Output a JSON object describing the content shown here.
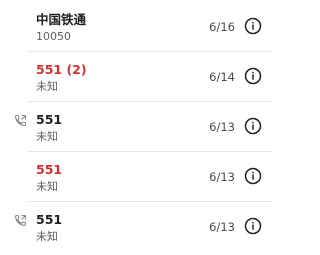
{
  "call_log": {
    "rows": [
      {
        "name": "中国铁通",
        "number_or_location": "10050",
        "date": "6/16",
        "missed": false,
        "call_type_icon": null,
        "info_icon": "info-icon"
      },
      {
        "name": "551 (2)",
        "number_or_location": "未知",
        "date": "6/14",
        "missed": true,
        "call_type_icon": null,
        "info_icon": "info-icon"
      },
      {
        "name": "551",
        "number_or_location": "未知",
        "date": "6/13",
        "missed": false,
        "call_type_icon": "outgoing-call-icon",
        "info_icon": "info-icon"
      },
      {
        "name": "551",
        "number_or_location": "未知",
        "date": "6/13",
        "missed": true,
        "call_type_icon": null,
        "info_icon": "info-icon"
      },
      {
        "name": "551",
        "number_or_location": "未知",
        "date": "6/13",
        "missed": false,
        "call_type_icon": "outgoing-call-icon",
        "info_icon": "info-icon"
      }
    ]
  },
  "colors": {
    "missed_text": "#d32f2f",
    "primary_text": "#212121",
    "secondary_text": "#5f5f5f"
  }
}
